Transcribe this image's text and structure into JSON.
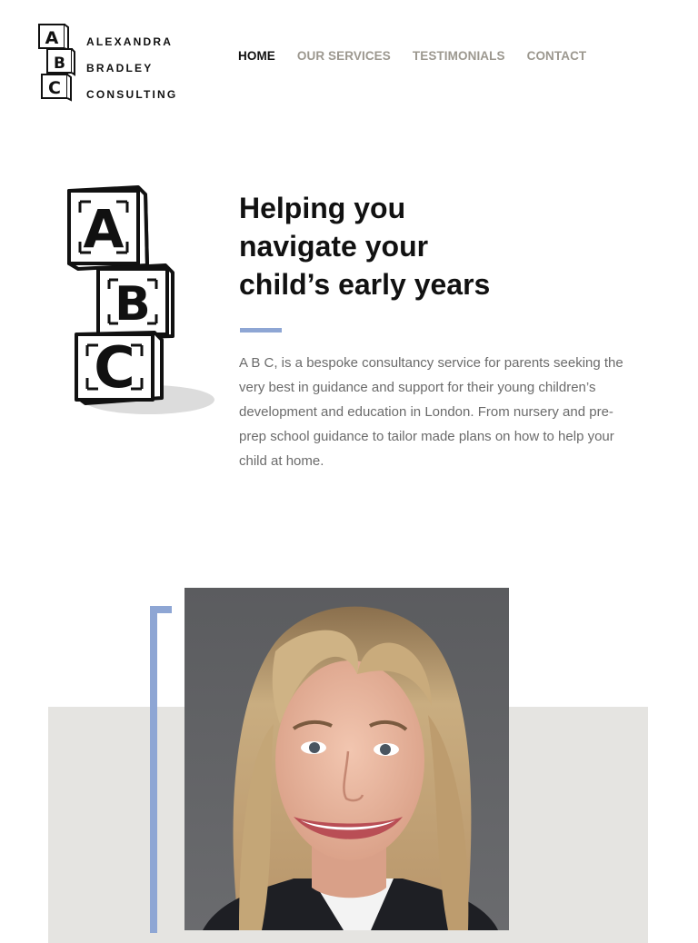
{
  "brand": {
    "line1": "ALEXANDRA",
    "line2": "BRADLEY",
    "line3": "CONSULTING",
    "block_letters": [
      "A",
      "B",
      "C"
    ]
  },
  "nav": {
    "items": [
      {
        "label": "HOME",
        "active": true
      },
      {
        "label": "OUR SERVICES",
        "active": false
      },
      {
        "label": "TESTIMONIALS",
        "active": false
      },
      {
        "label": "CONTACT",
        "active": false
      }
    ]
  },
  "hero": {
    "title_lines": [
      "Helping you",
      "navigate your",
      "child’s early years"
    ],
    "body": "A B C, is a bespoke consultancy service for parents seeking the very best in guidance and support for their young children’s development and education in London. From nursery and pre-prep school guidance to tailor made plans on how to help your child at home."
  },
  "colors": {
    "accent": "#8ea6d4",
    "panel": "#e5e4e1",
    "nav_inactive": "#9c988f",
    "body_text": "#6b6b6b"
  }
}
